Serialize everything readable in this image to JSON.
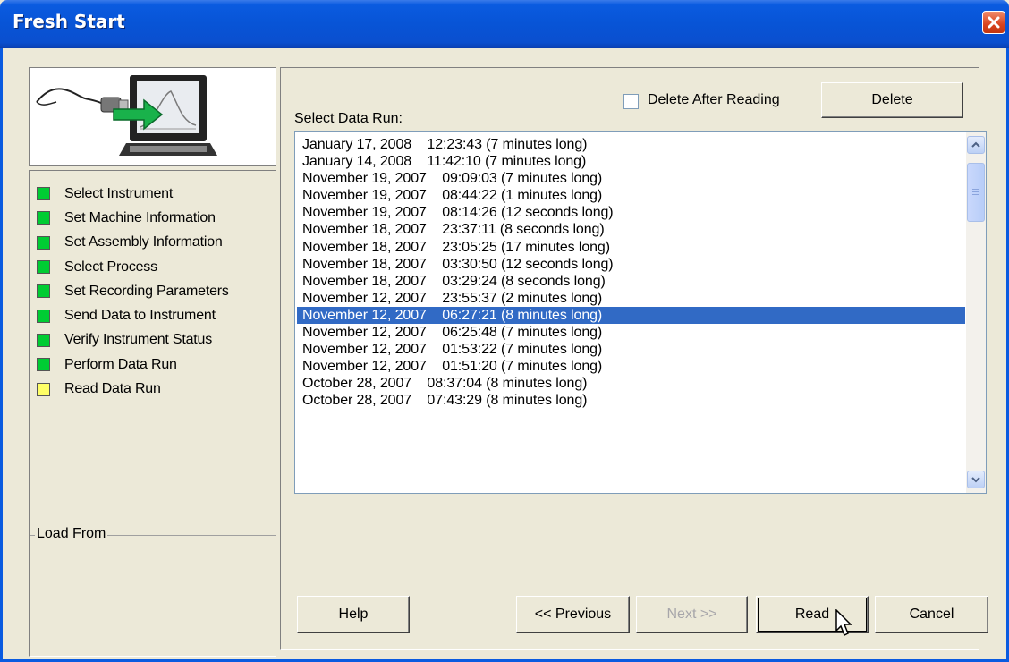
{
  "window": {
    "title": "Fresh Start",
    "close_icon": "close-icon"
  },
  "steps": [
    {
      "label": "Select Instrument",
      "status": "complete",
      "color": "#00cc33"
    },
    {
      "label": "Set Machine Information",
      "status": "complete",
      "color": "#00cc33"
    },
    {
      "label": "Set Assembly Information",
      "status": "complete",
      "color": "#00cc33"
    },
    {
      "label": "Select Process",
      "status": "complete",
      "color": "#00cc33"
    },
    {
      "label": "Set Recording Parameters",
      "status": "complete",
      "color": "#00cc33"
    },
    {
      "label": "Send Data to Instrument",
      "status": "complete",
      "color": "#00cc33"
    },
    {
      "label": "Verify Instrument Status",
      "status": "complete",
      "color": "#00cc33"
    },
    {
      "label": "Perform Data Run",
      "status": "complete",
      "color": "#00cc33"
    },
    {
      "label": "Read Data Run",
      "status": "current",
      "color": "#ffff66"
    }
  ],
  "load_from": {
    "label": "Load From"
  },
  "options": {
    "delete_after_reading_label": "Delete After Reading",
    "delete_after_reading_checked": false,
    "delete_label": "Delete"
  },
  "data_runs": {
    "label": "Select Data Run:",
    "selected_index": 10,
    "items": [
      "January 17, 2008    12:23:43 (7 minutes long)",
      "January 14, 2008    11:42:10 (7 minutes long)",
      "November 19, 2007    09:09:03 (7 minutes long)",
      "November 19, 2007    08:44:22 (1 minutes long)",
      "November 19, 2007    08:14:26 (12 seconds long)",
      "November 18, 2007    23:37:11 (8 seconds long)",
      "November 18, 2007    23:05:25 (17 minutes long)",
      "November 18, 2007    03:30:50 (12 seconds long)",
      "November 18, 2007    03:29:24 (8 seconds long)",
      "November 12, 2007    23:55:37 (2 minutes long)",
      "November 12, 2007    06:27:21 (8 minutes long)",
      "November 12, 2007    06:25:48 (7 minutes long)",
      "November 12, 2007    01:53:22 (7 minutes long)",
      "November 12, 2007    01:51:20 (7 minutes long)",
      "October 28, 2007    08:37:04 (8 minutes long)",
      "October 28, 2007    07:43:29 (8 minutes long)"
    ]
  },
  "buttons": {
    "help": "Help",
    "previous": "<< Previous",
    "next": "Next >>",
    "read": "Read",
    "cancel": "Cancel"
  },
  "colors": {
    "title_bar": "#0854d6",
    "selection": "#316ac5",
    "step_complete": "#00cc33",
    "step_current": "#ffff66"
  }
}
